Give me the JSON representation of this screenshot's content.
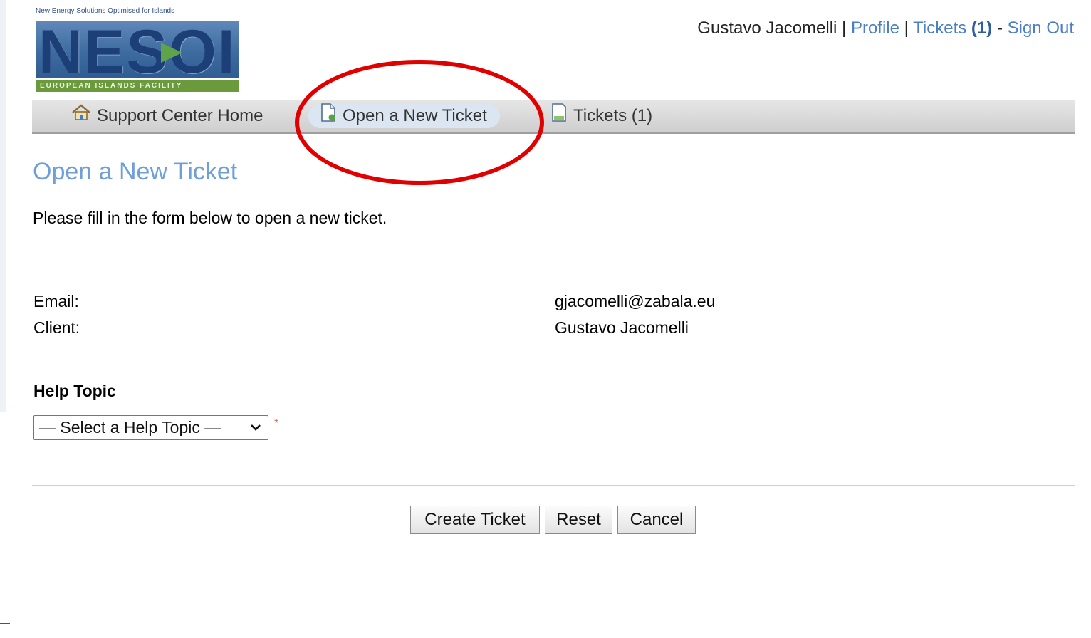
{
  "logo": {
    "tagline": "New Energy Solutions Optimised for Islands",
    "wordmark": "NESOI",
    "strip": "EUROPEAN ISLANDS FACILITY"
  },
  "userbar": {
    "user_name": "Gustavo Jacomelli",
    "sep1": "|",
    "profile_link": "Profile",
    "sep2": "|",
    "tickets_link": "Tickets",
    "tickets_count": "(1)",
    "dash": "-",
    "signout_link": "Sign Out"
  },
  "nav": {
    "home": {
      "label": "Support Center Home",
      "icon": "home-icon"
    },
    "open": {
      "label": "Open a New Ticket",
      "icon": "new-ticket-icon"
    },
    "tickets": {
      "label": "Tickets (1)",
      "icon": "tickets-icon"
    }
  },
  "content": {
    "title": "Open a New Ticket",
    "intro": "Please fill in the form below to open a new ticket.",
    "email_label": "Email:",
    "email_value": "gjacomelli@zabala.eu",
    "client_label": "Client:",
    "client_value": "Gustavo Jacomelli",
    "help_topic_heading": "Help Topic",
    "help_topic_selected": "— Select a Help Topic —",
    "required_marker": "*"
  },
  "buttons": {
    "create": "Create Ticket",
    "reset": "Reset",
    "cancel": "Cancel"
  },
  "colors": {
    "link": "#4b7fc4",
    "title": "#6e9fd8",
    "annotation": "#e00000"
  }
}
